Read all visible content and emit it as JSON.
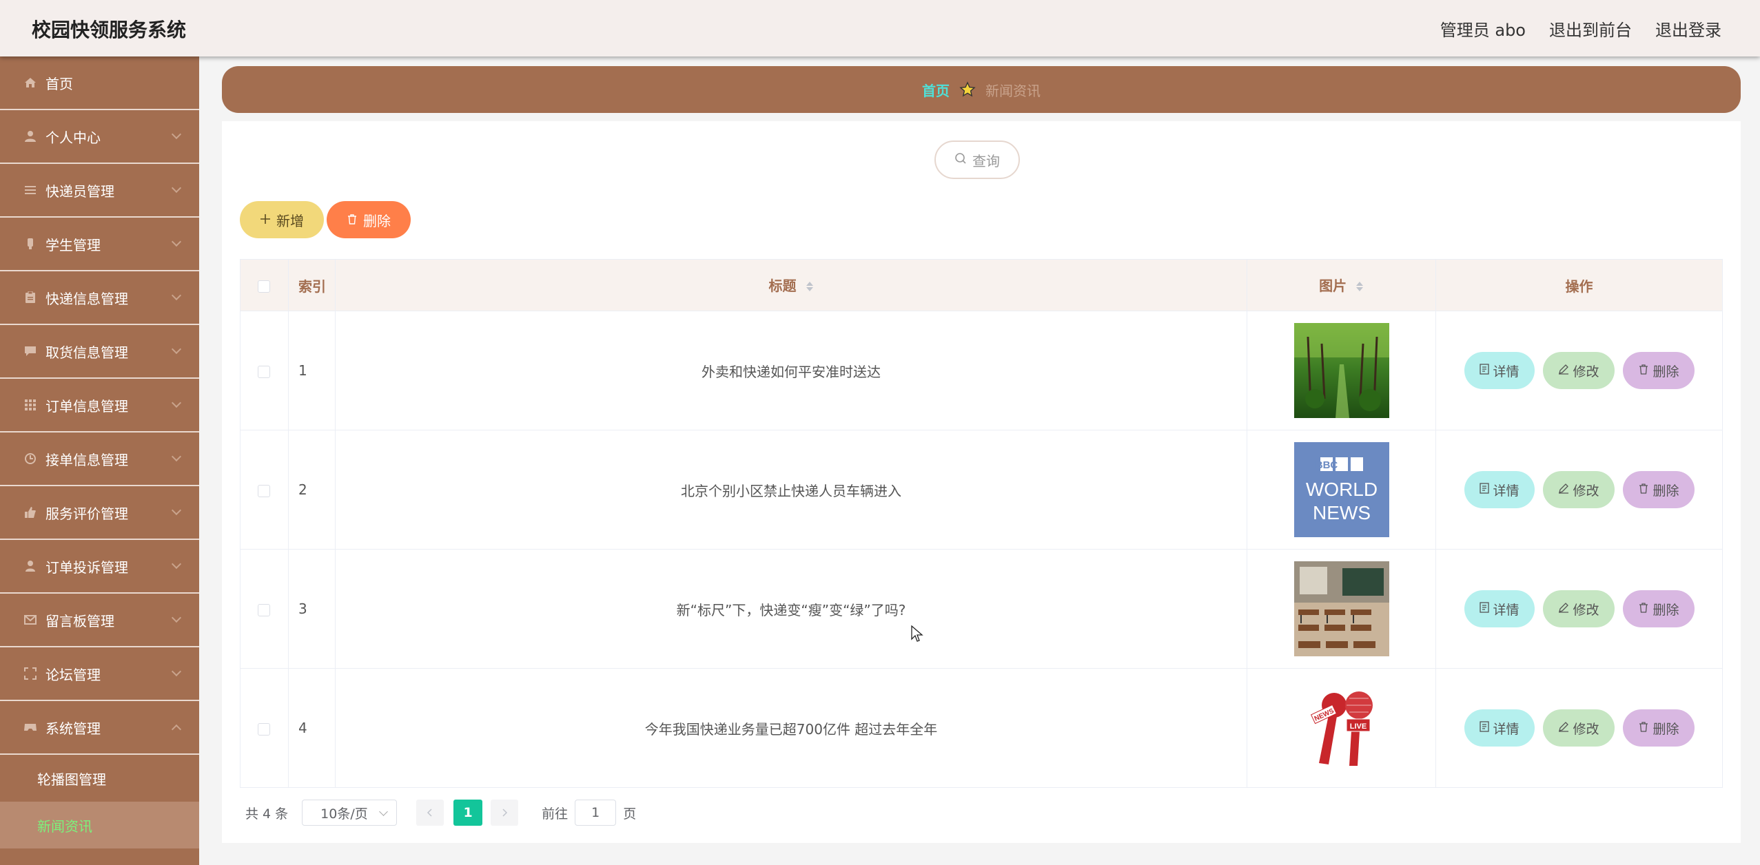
{
  "app": {
    "title": "校园快领服务系统"
  },
  "header": {
    "admin_label": "管理员 abo",
    "to_front_label": "退出到前台",
    "logout_label": "退出登录"
  },
  "sidebar": {
    "items": [
      {
        "label": "首页",
        "icon": "home-icon",
        "arrow": "none"
      },
      {
        "label": "个人中心",
        "icon": "user-icon",
        "arrow": "down"
      },
      {
        "label": "快递员管理",
        "icon": "menu-lines-icon",
        "arrow": "down"
      },
      {
        "label": "学生管理",
        "icon": "student-icon",
        "arrow": "down"
      },
      {
        "label": "快递信息管理",
        "icon": "clipboard-icon",
        "arrow": "down"
      },
      {
        "label": "取货信息管理",
        "icon": "chat-icon",
        "arrow": "down"
      },
      {
        "label": "订单信息管理",
        "icon": "grid-icon",
        "arrow": "down"
      },
      {
        "label": "接单信息管理",
        "icon": "clock-icon",
        "arrow": "down"
      },
      {
        "label": "服务评价管理",
        "icon": "thumb-icon",
        "arrow": "down"
      },
      {
        "label": "订单投诉管理",
        "icon": "person-icon",
        "arrow": "down"
      },
      {
        "label": "留言板管理",
        "icon": "mail-icon",
        "arrow": "down"
      },
      {
        "label": "论坛管理",
        "icon": "frame-icon",
        "arrow": "down"
      },
      {
        "label": "系统管理",
        "icon": "gamepad-icon",
        "arrow": "up"
      }
    ],
    "sub_items": [
      {
        "label": "轮播图管理",
        "active": false
      },
      {
        "label": "新闻资讯",
        "active": true
      }
    ]
  },
  "breadcrumb": {
    "home": "首页",
    "current": "新闻资讯",
    "icon": "star-icon"
  },
  "toolbar": {
    "search_label": "查询",
    "add_label": "新增",
    "delete_label": "删除"
  },
  "table": {
    "headers": {
      "index": "索引",
      "title": "标题",
      "image": "图片",
      "actions": "操作"
    },
    "rows": [
      {
        "index": "1",
        "title": "外卖和快递如何平安准时送达",
        "image": "tree-avenue-image"
      },
      {
        "index": "2",
        "title": "北京个别小区禁止快递人员车辆进入",
        "image": "bbc-world-news-image",
        "image_text": [
          "BBC",
          "WORLD",
          "NEWS"
        ]
      },
      {
        "index": "3",
        "title": "新“标尺”下，快递变“瘦”变“绿”了吗?",
        "image": "classroom-image"
      },
      {
        "index": "4",
        "title": "今年我国快递业务量已超700亿件 超过去年全年",
        "image": "news-microphones-image",
        "image_text": [
          "NEWS",
          "LIVE"
        ]
      }
    ],
    "row_actions": {
      "detail": "详情",
      "edit": "修改",
      "remove": "删除"
    }
  },
  "pagination": {
    "total_label": "共 4 条",
    "page_size_label": "10条/页",
    "current_page": "1",
    "goto_prefix": "前往",
    "goto_value": "1",
    "goto_suffix": "页"
  },
  "colors": {
    "sidebar_bg": "#a36e50",
    "header_bg": "#f4eeec",
    "accent_teal": "#4fe0d8",
    "active_sub": "#7cf27c",
    "add_btn": "#f2d87a",
    "delete_btn": "#ff7f49",
    "pager_active": "#13c59a"
  }
}
